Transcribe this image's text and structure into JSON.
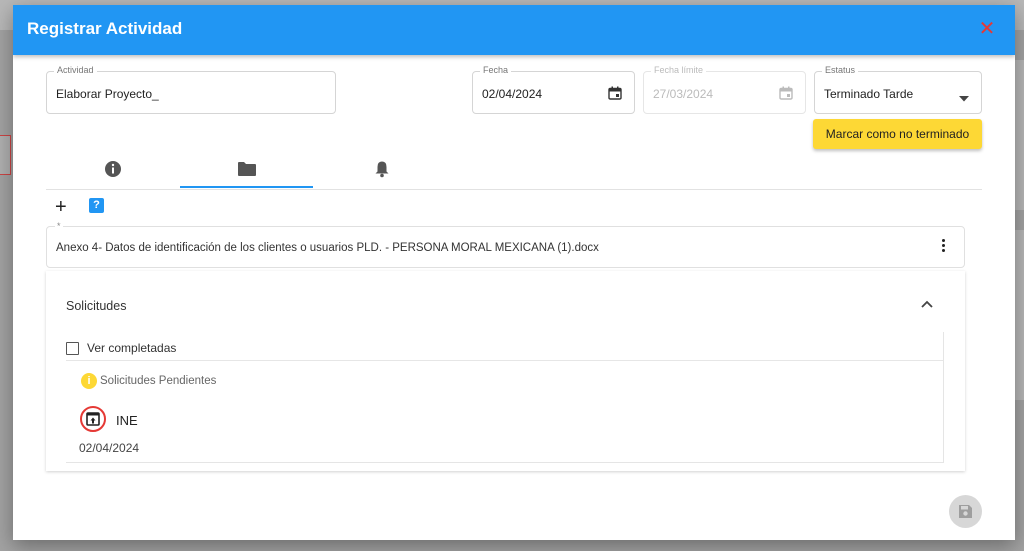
{
  "dialog": {
    "title": "Registrar Actividad"
  },
  "fields": {
    "actividad": {
      "label": "Actividad",
      "value": "Elaborar Proyecto_"
    },
    "fecha": {
      "label": "Fecha",
      "value": "02/04/2024"
    },
    "fecha_limite": {
      "label": "Fecha límite",
      "value": "27/03/2024"
    },
    "estatus": {
      "label": "Estatus",
      "value": "Terminado Tarde"
    }
  },
  "buttons": {
    "mark_unfinished": "Marcar como no terminado"
  },
  "tabs": [
    {
      "icon": "info-icon",
      "active": false
    },
    {
      "icon": "folder-icon",
      "active": true
    },
    {
      "icon": "bell-icon",
      "active": false
    }
  ],
  "toolbar": {
    "add_icon": "+",
    "help_icon": "?"
  },
  "file": {
    "marker": "*",
    "name": "Anexo 4- Datos de identificación de los clientes o usuarios PLD. - PERSONA MORAL MEXICANA (1).docx"
  },
  "solicitudes": {
    "title": "Solicitudes",
    "show_completed_label": "Ver completadas",
    "pending_icon": "i",
    "pending_label": "Solicitudes Pendientes",
    "items": [
      {
        "name": "INE",
        "date": "02/04/2024"
      }
    ]
  },
  "colors": {
    "header": "#2196f3",
    "close": "#e53935",
    "accent_yellow": "#fdd835"
  }
}
